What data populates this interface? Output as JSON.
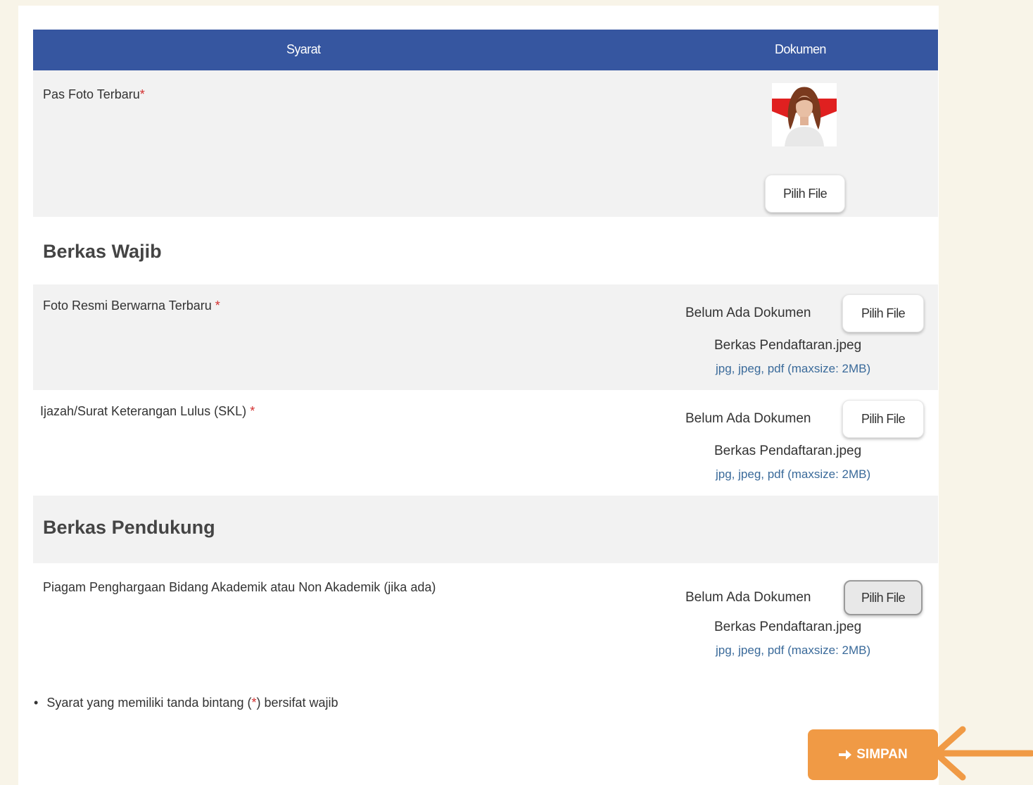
{
  "table": {
    "header_syarat": "Syarat",
    "header_dokumen": "Dokumen"
  },
  "pas_foto": {
    "label": "Pas Foto Terbaru",
    "required_mark": "*",
    "button_label": "Pilih File"
  },
  "berkas_wajib": {
    "title": "Berkas Wajib",
    "items": [
      {
        "label": "Foto Resmi Berwarna Terbaru ",
        "required_mark": "*",
        "status": "Belum Ada Dokumen",
        "button_label": "Pilih File",
        "file_name": "Berkas Pendaftaran.jpeg",
        "hint": "jpg, jpeg, pdf (maxsize: 2MB)"
      },
      {
        "label": "Ijazah/Surat Keterangan Lulus (SKL) ",
        "required_mark": "*",
        "status": "Belum Ada Dokumen",
        "button_label": "Pilih File",
        "file_name": "Berkas Pendaftaran.jpeg",
        "hint": "jpg, jpeg, pdf (maxsize: 2MB)"
      }
    ]
  },
  "berkas_pendukung": {
    "title": "Berkas Pendukung",
    "items": [
      {
        "label": "Piagam Penghargaan Bidang Akademik atau Non Akademik (jika ada)",
        "status": "Belum Ada Dokumen",
        "button_label": "Pilih File",
        "file_name": "Berkas Pendaftaran.jpeg",
        "hint": "jpg, jpeg, pdf (maxsize: 2MB)"
      }
    ]
  },
  "note": {
    "bullet": "•",
    "text_before": "Syarat yang memiliki tanda bintang (",
    "star": "*",
    "text_after": ") bersifat wajib"
  },
  "save_button": {
    "label": "SIMPAN",
    "icon": "arrow-right-icon",
    "color": "#f09a45"
  },
  "colors": {
    "header_bg": "#3656a0",
    "row_alt_bg": "#f2f2f2",
    "page_bg": "#f8f4e8",
    "required": "#d32f2f",
    "hint": "#3a6a9a",
    "annotation_arrow": "#f09a45"
  }
}
